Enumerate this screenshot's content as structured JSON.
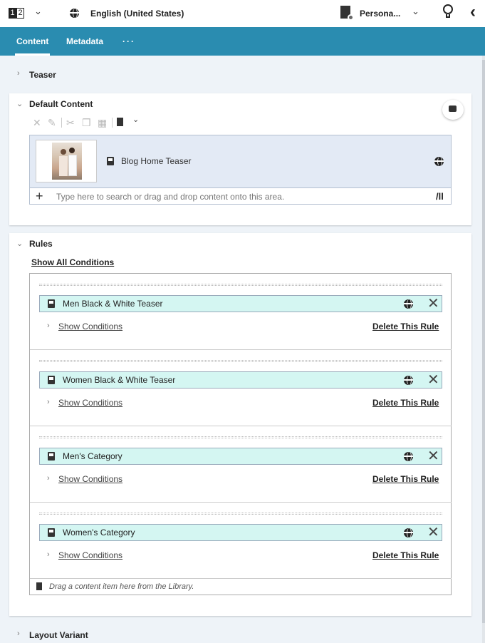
{
  "topbar": {
    "page_indicator_1": "1",
    "page_indicator_2": "2",
    "language": "English (United States)",
    "persona": "Persona...",
    "icons": [
      "page-switch-icon",
      "chevron-down-icon",
      "globe-icon",
      "personalization-icon",
      "lightbulb-icon",
      "collapse-left-icon"
    ]
  },
  "tabs": [
    {
      "label": "Content",
      "active": true
    },
    {
      "label": "Metadata",
      "active": false
    },
    {
      "label": "···",
      "active": false
    }
  ],
  "sections": {
    "teaser": "Teaser",
    "default_content": "Default Content",
    "rules": "Rules",
    "layout_variant": "Layout Variant"
  },
  "default_content": {
    "item_name": "Blog Home Teaser",
    "search_placeholder": "Type here to search or drag and drop content onto this area."
  },
  "rules": {
    "show_all": "Show All Conditions",
    "items": [
      {
        "name": "Men Black & White Teaser",
        "show_conditions": "Show Conditions",
        "delete": "Delete This Rule"
      },
      {
        "name": "Women Black & White Teaser",
        "show_conditions": "Show Conditions",
        "delete": "Delete This Rule"
      },
      {
        "name": "Men's Category",
        "show_conditions": "Show Conditions",
        "delete": "Delete This Rule"
      },
      {
        "name": "Women's Category",
        "show_conditions": "Show Conditions",
        "delete": "Delete This Rule"
      }
    ],
    "drop_hint": "Drag a content item here from the Library."
  },
  "colors": {
    "tab_bar": "#2a8cb0",
    "panel_bg": "#eef3f8",
    "rule_item_bg": "#d4f6f2",
    "default_item_bg": "#e3eaf5"
  }
}
